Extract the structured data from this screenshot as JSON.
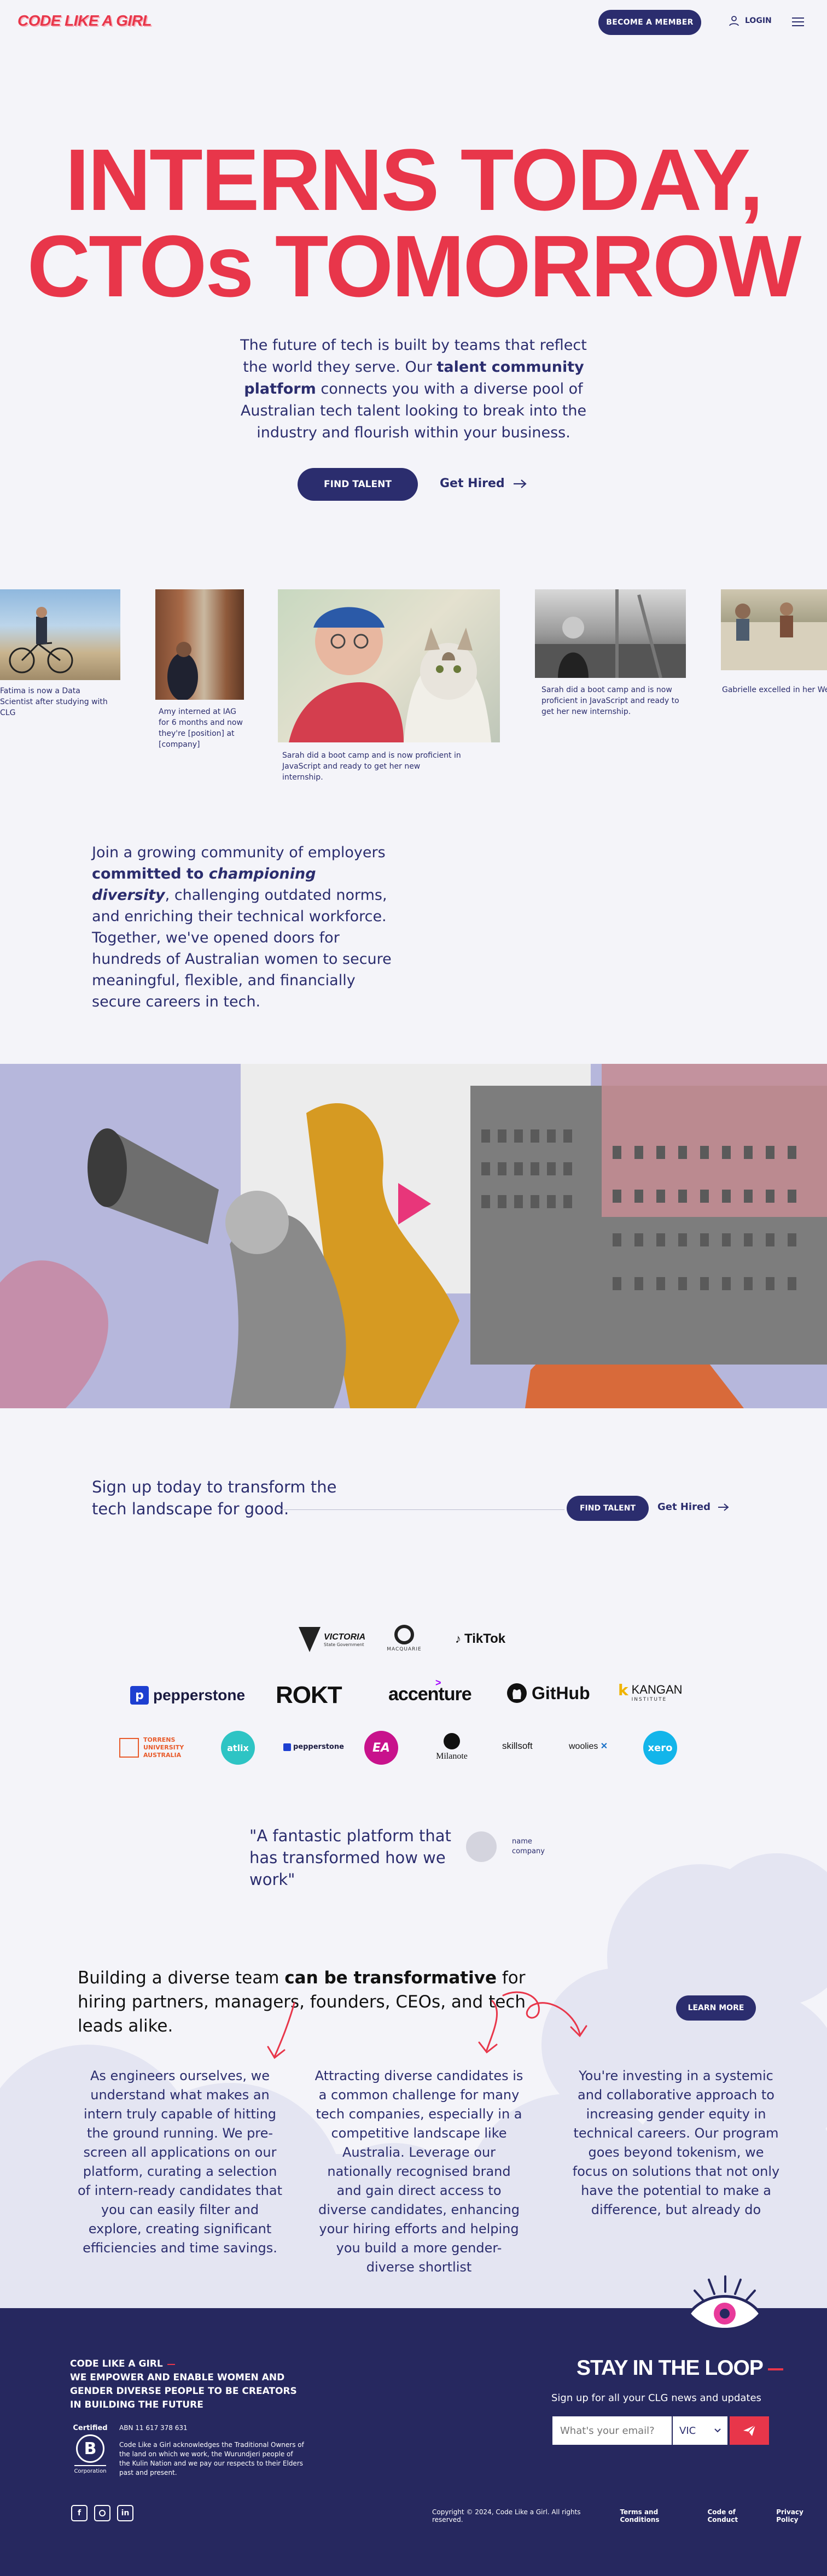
{
  "header": {
    "logo": "CODE LIKE A GIRL",
    "member_button": "BECOME A MEMBER",
    "login": "LOGIN"
  },
  "hero": {
    "title_line1": "INTERNS TODAY,",
    "title_line2": "CTOs TOMORROW",
    "sub_before": "The future of tech is built by teams that reflect the world they serve. Our ",
    "sub_bold": "talent community platform",
    "sub_after": " connects you with a diverse pool of Australian tech talent looking to break into the industry and flourish within your business.",
    "find_talent": "FIND TALENT",
    "get_hired": "Get Hired"
  },
  "gallery": [
    {
      "caption": "Fatima is now a Data Scientist after studying with CLG"
    },
    {
      "caption": "Amy interned at IAG for 6 months and now they're [position] at [company]"
    },
    {
      "caption": "Sarah did a boot camp and is now proficient in JavaScript and ready to get her new internship."
    },
    {
      "caption": "Sarah did a boot camp and is now proficient in JavaScript and ready to get her new internship."
    },
    {
      "caption": "Gabrielle excelled in her Web"
    }
  ],
  "community": {
    "before": "Join a growing community of employers ",
    "bold": "committed to ",
    "bold_italic": "championing diversity",
    "after": ", challenging outdated norms, and enriching their technical workforce. Together, we've opened doors for hundreds of Australian women to secure meaningful, flexible, and financially secure careers in tech."
  },
  "signup": {
    "text": "Sign up today to transform the tech landscape for good.",
    "find_talent": "FIND TALENT",
    "get_hired": "Get Hired"
  },
  "partners": {
    "row1": [
      "VICTORIA",
      "MACQUARIE",
      "TikTok"
    ],
    "row2": [
      "pepperstone",
      "ROKT",
      "accenture",
      "GitHub",
      "KANGAN"
    ],
    "row3": [
      "TORRENS UNIVERSITY AUSTRALIA",
      "atlix",
      "pepperstone",
      "EA",
      "Milanote",
      "skillsoft",
      "woolies",
      "xero"
    ],
    "victoria_sub": "State Government",
    "kangan_sub": "INSTITUTE"
  },
  "testimonial": {
    "quote": "\"A fantastic platform that has transformed how we work\"",
    "name": "name",
    "company": "company"
  },
  "transform": {
    "before": "Building a diverse team ",
    "bold": "can be transformative",
    "after": " for hiring partners, managers, founders, CEOs, and tech leads alike.",
    "learn_more": "LEARN MORE",
    "col1": "As engineers ourselves, we understand what makes an intern truly capable of hitting the ground running. We pre-screen all applications on our platform, curating a selection of intern-ready candidates that you can easily filter and explore, creating significant efficiencies and time savings.",
    "col2": "Attracting diverse candidates is a common challenge for many tech companies, especially in a competitive landscape like Australia. Leverage our nationally recognised brand and gain direct access to diverse candidates, enhancing your hiring efforts and helping you build a more gender-diverse shortlist",
    "col3": "You're investing in a systemic and collaborative approach to increasing gender equity in technical careers. Our program goes beyond tokenism, we focus on solutions that not only have the potential to make a difference, but already do"
  },
  "footer": {
    "brand": "CODE LIKE A GIRL",
    "mission": "WE EMPOWER AND ENABLE WOMEN AND GENDER DIVERSE PEOPLE TO BE CREATORS IN BUILDING THE FUTURE",
    "certified": "Certified",
    "corporation": "Corporation",
    "abn": "ABN 11 617 378 631",
    "acknowledgement": "Code Like a Girl acknowledges the Traditional Owners of the land on which we work, the Wurundjeri people of the Kulin Nation and we pay our respects to their Elders past and present.",
    "stay_title": "STAY IN THE LOOP",
    "stay_sub": "Sign up for all your CLG news and updates",
    "email_placeholder": "What's your email?",
    "state": "VIC",
    "copyright": "Copyright © 2024, Code Like a Girl. All rights reserved.",
    "terms": "Terms and Conditions",
    "conduct": "Code of Conduct",
    "privacy": "Privacy Policy"
  },
  "colors": {
    "accent": "#e8364a",
    "navy": "#2b2d6e",
    "footer": "#26285f",
    "bg": "#f4f4f9"
  }
}
